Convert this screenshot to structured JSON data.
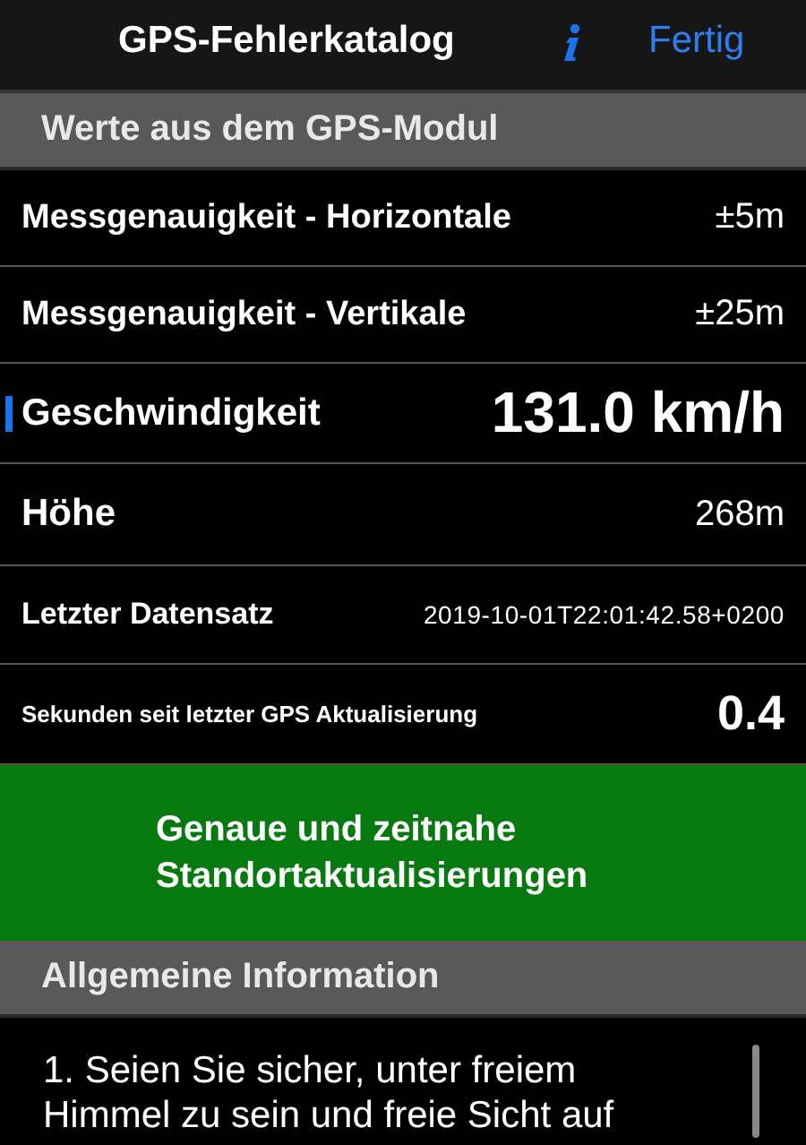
{
  "nav_bar": {
    "title": "GPS-Fehlerkatalog",
    "done_button": "Fertig"
  },
  "sections": [
    {
      "header": "Werte aus dem GPS-Modul"
    }
  ],
  "rows": [
    {
      "kind": "medium",
      "label": "Messgenauigkeit - Horizontale",
      "value": "±5m",
      "marked": false
    },
    {
      "kind": "medium",
      "label": "Messgenauigkeit - Vertikale",
      "value": "±25m",
      "marked": false
    },
    {
      "kind": "large",
      "label": "Geschwindigkeit",
      "value": "131.0 km/h",
      "marked": true
    },
    {
      "kind": "plain",
      "label": "Höhe",
      "value": "268m",
      "marked": false
    },
    {
      "kind": "detail",
      "label": "Letzter Datensatz",
      "value": "2019-10-01T22:01:42.58+0200",
      "marked": false
    },
    {
      "kind": "small",
      "label": "Sekunden seit letzter GPS Aktualisierung",
      "value": "0.4",
      "marked": false
    }
  ],
  "status_banner": {
    "text": "Genaue und zeitnahe Standortaktualisierungen",
    "color": "#067a0e"
  },
  "info_section": {
    "header": "Allgemeine Information",
    "text": "1. Seien Sie sicher, unter freiem Himmel zu sein und freie Sicht auf"
  }
}
